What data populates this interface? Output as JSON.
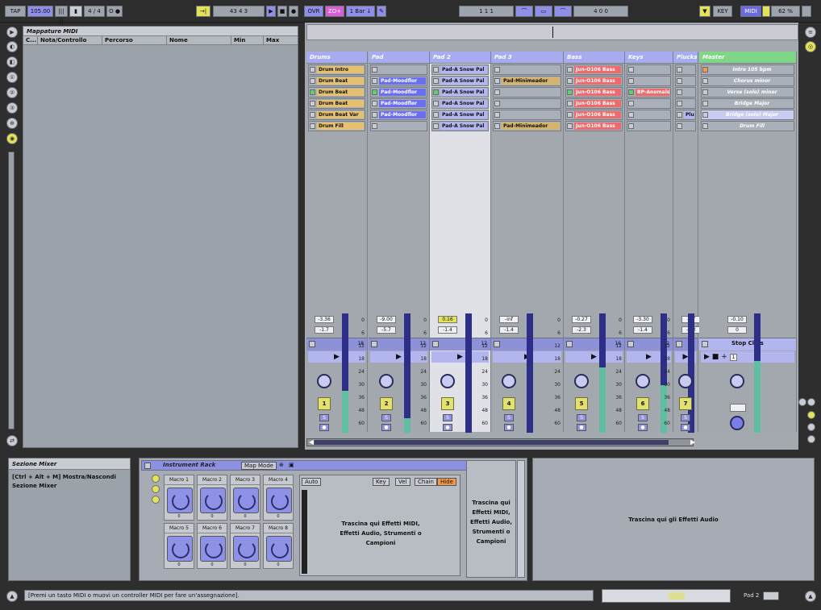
{
  "topbar": {
    "tap": "TAP",
    "tempo": "105.00",
    "tempo_nudge": "||| ||",
    "signature": "4 / 4",
    "metronome": "O ●",
    "follow": "→|",
    "position": "43   4   3",
    "ovr": "OVR",
    "punch": "ZO+",
    "quantize": "1 Bar ↓",
    "loop_start": "1    1    1",
    "loop_length": "4    0    0",
    "key": "KEY",
    "midi": "MIDI",
    "cpu": "62 %"
  },
  "browser": {
    "title": "Mappature MIDI",
    "columns": [
      "C...",
      "Nota/Controllo",
      "Percorso",
      "Nome",
      "Min",
      "Max"
    ]
  },
  "tracks": [
    {
      "name": "Drums",
      "vol": "-3.36",
      "pan": "-1.7",
      "num": "1",
      "send": "18",
      "color": "#e5c16f",
      "clips": [
        {
          "t": "Drum Intro",
          "c": "y"
        },
        {
          "t": "Drum Beat",
          "c": "y"
        },
        {
          "t": "Drum Beat",
          "c": "y",
          "playing": true
        },
        {
          "t": "Drum Beat",
          "c": "y"
        },
        {
          "t": "Drum Beat Var",
          "c": "y"
        },
        {
          "t": "Drum Fill",
          "c": "y"
        }
      ],
      "meter": 0.35
    },
    {
      "name": "Pad",
      "vol": "-9.00",
      "pan": "-5.7",
      "num": "2",
      "send": "12",
      "clips": [
        {
          "t": "",
          "c": ""
        },
        {
          "t": "Pad-Moodflor",
          "c": "b"
        },
        {
          "t": "Pad-Moodflor",
          "c": "b",
          "playing": true
        },
        {
          "t": "Pad-Moodflor",
          "c": "b"
        },
        {
          "t": "Pad-Moodflor",
          "c": "b"
        },
        {
          "t": "",
          "c": ""
        }
      ],
      "meter": 0.12
    },
    {
      "name": "Pad 2",
      "vol": "0.16",
      "pan": "-1.4",
      "num": "3",
      "send": "12",
      "selected": true,
      "clips": [
        {
          "t": "Pad-A Snow Pal",
          "c": "lb"
        },
        {
          "t": "Pad-A Snow Pal",
          "c": "lb"
        },
        {
          "t": "Pad-A Snow Pal",
          "c": "lb",
          "playing": true
        },
        {
          "t": "Pad-A Snow Pal",
          "c": "lb"
        },
        {
          "t": "Pad-A Snow Pal",
          "c": "lb"
        },
        {
          "t": "Pad-A Snow Pal",
          "c": "lb"
        }
      ],
      "meter": 0.0
    },
    {
      "name": "Pad 3",
      "vol": "-inf",
      "pan": "-1.4",
      "num": "4",
      "send": "",
      "clips": [
        {
          "t": "",
          "c": ""
        },
        {
          "t": "Pad-Minimeador",
          "c": "tan"
        },
        {
          "t": "",
          "c": ""
        },
        {
          "t": "",
          "c": ""
        },
        {
          "t": "",
          "c": ""
        },
        {
          "t": "Pad-Minimeador",
          "c": "tan"
        }
      ],
      "meter": 0.0
    },
    {
      "name": "Bass",
      "vol": "-0.27",
      "pan": "-2.3",
      "num": "5",
      "send": "16",
      "clips": [
        {
          "t": "Jun-O106 Bass",
          "c": "r"
        },
        {
          "t": "Jun-O106 Bass",
          "c": "r"
        },
        {
          "t": "Jun-O106 Bass",
          "c": "r",
          "playing": true
        },
        {
          "t": "Jun-O106 Bass",
          "c": "r"
        },
        {
          "t": "Jun-O106 Bass",
          "c": "r"
        },
        {
          "t": "Jun-O106 Bass",
          "c": "r"
        }
      ],
      "meter": 0.55
    },
    {
      "name": "Keys",
      "vol": "-3.30",
      "pan": "-1.4",
      "num": "6",
      "send": "32",
      "clips": [
        {
          "t": "",
          "c": ""
        },
        {
          "t": "",
          "c": ""
        },
        {
          "t": "BP-Anomalo",
          "c": "r",
          "playing": true
        },
        {
          "t": "",
          "c": ""
        },
        {
          "t": "",
          "c": ""
        },
        {
          "t": "",
          "c": ""
        }
      ],
      "meter": 0.4
    },
    {
      "name": "Plucks",
      "vol": "-inf",
      "pan": "-6.2",
      "num": "7",
      "send": "",
      "clips": [
        {
          "t": "",
          "c": ""
        },
        {
          "t": "",
          "c": ""
        },
        {
          "t": "",
          "c": ""
        },
        {
          "t": "",
          "c": ""
        },
        {
          "t": "Plu",
          "c": "lb"
        },
        {
          "t": "",
          "c": ""
        }
      ],
      "meter": 0.0
    }
  ],
  "master": {
    "name": "Master",
    "scenes": [
      "Intro 105 bpm",
      "Chorus minor",
      "Verse (solo) minor",
      "Bridge Major",
      "Bridge (solo) Major",
      "Drum Fill"
    ],
    "stop_clips": "Stop Clips",
    "quant": "1",
    "vol": "-0.10",
    "pan": "0",
    "meter": 0.6
  },
  "scale_labels": [
    "0",
    "6",
    "12",
    "18",
    "24",
    "30",
    "36",
    "48",
    "60"
  ],
  "mixer_info": {
    "title": "Sezione Mixer",
    "text": "[Ctrl + Alt + M] Mostra/Nascondi Sezione Mixer"
  },
  "rack": {
    "title": "Instrument Rack",
    "map_mode": "Map Mode",
    "macros": [
      {
        "label": "Macro 1",
        "value": "0"
      },
      {
        "label": "Macro 2",
        "value": "0"
      },
      {
        "label": "Macro 3",
        "value": "0"
      },
      {
        "label": "Macro 4",
        "value": "0"
      },
      {
        "label": "Macro 5",
        "value": "0"
      },
      {
        "label": "Macro 6",
        "value": "0"
      },
      {
        "label": "Macro 7",
        "value": "0"
      },
      {
        "label": "Macro 8",
        "value": "0"
      }
    ],
    "auto": "Auto",
    "chain_tabs": [
      "Key",
      "Vel",
      "Chain",
      "Hide"
    ],
    "drop_midi": "Trascina qui Effetti MIDI, Effetti Audio, Strumenti o Campioni",
    "drop_midi2": "Trascina qui Effetti MIDI, Effetti Audio, Strumenti o Campioni"
  },
  "audio_drop": "Trascina qui gli Effetti Audio",
  "status": {
    "text": "[Premi un tasto MIDI o muovi un controller MIDI per fare un'assegnazione].",
    "track": "Pad 2"
  },
  "colors": {
    "accent": "#e3e25a",
    "midi": "#6b6be0",
    "track_head": "#a7acf0",
    "master_head": "#7ed686"
  }
}
